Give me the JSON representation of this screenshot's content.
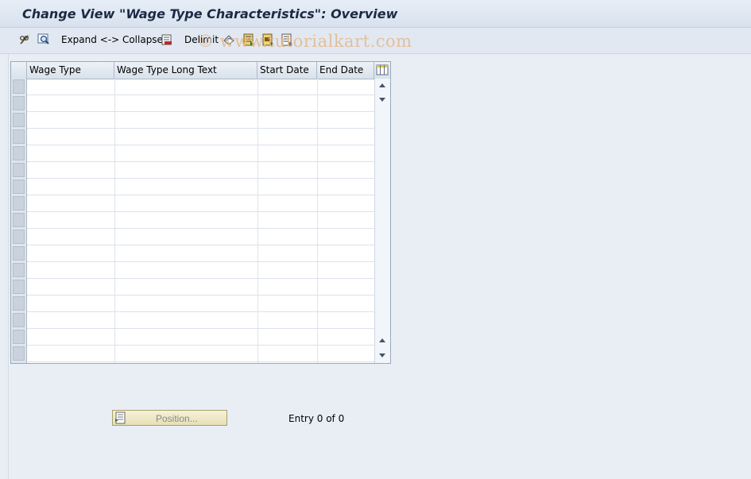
{
  "window": {
    "title": "Change View \"Wage Type Characteristics\": Overview"
  },
  "toolbar": {
    "display_change_icon": "glasses-pencil-icon",
    "details_icon": "magnifier-icon",
    "expand_collapse_label": "Expand <-> Collapse",
    "delimit_icon": "delimit-icon",
    "delimit_label": "Delimit",
    "undo_icon": "undo-icon",
    "select_all_icon": "select-all-icon",
    "select_block_icon": "select-block-icon",
    "deselect_all_icon": "deselect-all-icon"
  },
  "watermark": "© www.tutorialkart.com",
  "table": {
    "columns": [
      "Wage Type",
      "Wage Type Long Text",
      "Start Date",
      "End Date"
    ],
    "settings_icon": "column-settings-icon",
    "rows": [
      [
        "",
        "",
        "",
        ""
      ],
      [
        "",
        "",
        "",
        ""
      ],
      [
        "",
        "",
        "",
        ""
      ],
      [
        "",
        "",
        "",
        ""
      ],
      [
        "",
        "",
        "",
        ""
      ],
      [
        "",
        "",
        "",
        ""
      ],
      [
        "",
        "",
        "",
        ""
      ],
      [
        "",
        "",
        "",
        ""
      ],
      [
        "",
        "",
        "",
        ""
      ],
      [
        "",
        "",
        "",
        ""
      ],
      [
        "",
        "",
        "",
        ""
      ],
      [
        "",
        "",
        "",
        ""
      ],
      [
        "",
        "",
        "",
        ""
      ],
      [
        "",
        "",
        "",
        ""
      ],
      [
        "",
        "",
        "",
        ""
      ],
      [
        "",
        "",
        "",
        ""
      ],
      [
        "",
        "",
        "",
        ""
      ]
    ]
  },
  "footer": {
    "position_button_label": "Position...",
    "position_icon": "position-icon",
    "entry_text": "Entry 0 of 0"
  }
}
